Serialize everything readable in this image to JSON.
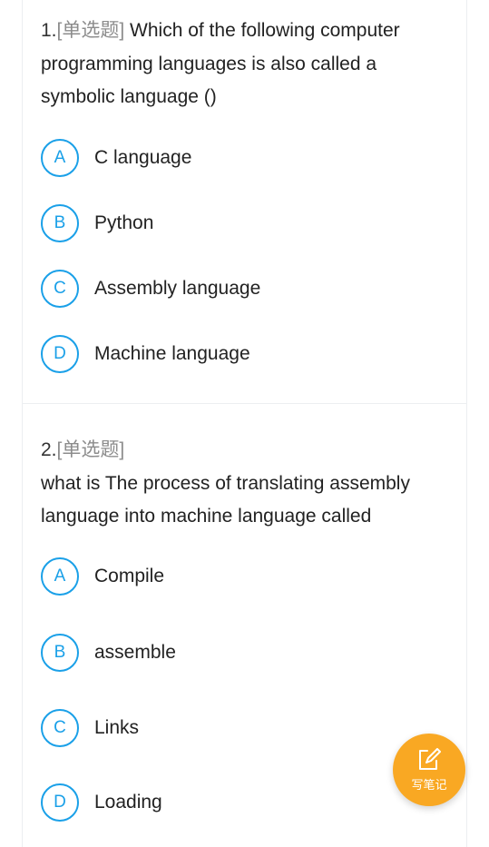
{
  "questions": [
    {
      "number": "1.",
      "type": "[单选题]",
      "text_line1": " Which of the following computer",
      "text_line2": "programming languages is also called a",
      "text_line3": "symbolic language ()",
      "options": [
        {
          "letter": "A",
          "text": "C language"
        },
        {
          "letter": "B",
          "text": "Python"
        },
        {
          "letter": "C",
          "text": "Assembly language"
        },
        {
          "letter": "D",
          "text": "Machine language"
        }
      ]
    },
    {
      "number": "2.",
      "type": "[单选题]",
      "text_line1": "what is The process of translating assembly",
      "text_line2": "language into machine language  called",
      "options": [
        {
          "letter": "A",
          "text": "Compile"
        },
        {
          "letter": "B",
          "text": "assemble"
        },
        {
          "letter": "C",
          "text": "Links"
        },
        {
          "letter": "D",
          "text": "Loading"
        }
      ]
    }
  ],
  "fab": {
    "label": "写笔记",
    "icon": "edit-note-icon"
  },
  "colors": {
    "accent": "#1aa0e8",
    "fab": "#f9a823",
    "question_type": "#8c8c8c",
    "divider": "#eceef1"
  }
}
